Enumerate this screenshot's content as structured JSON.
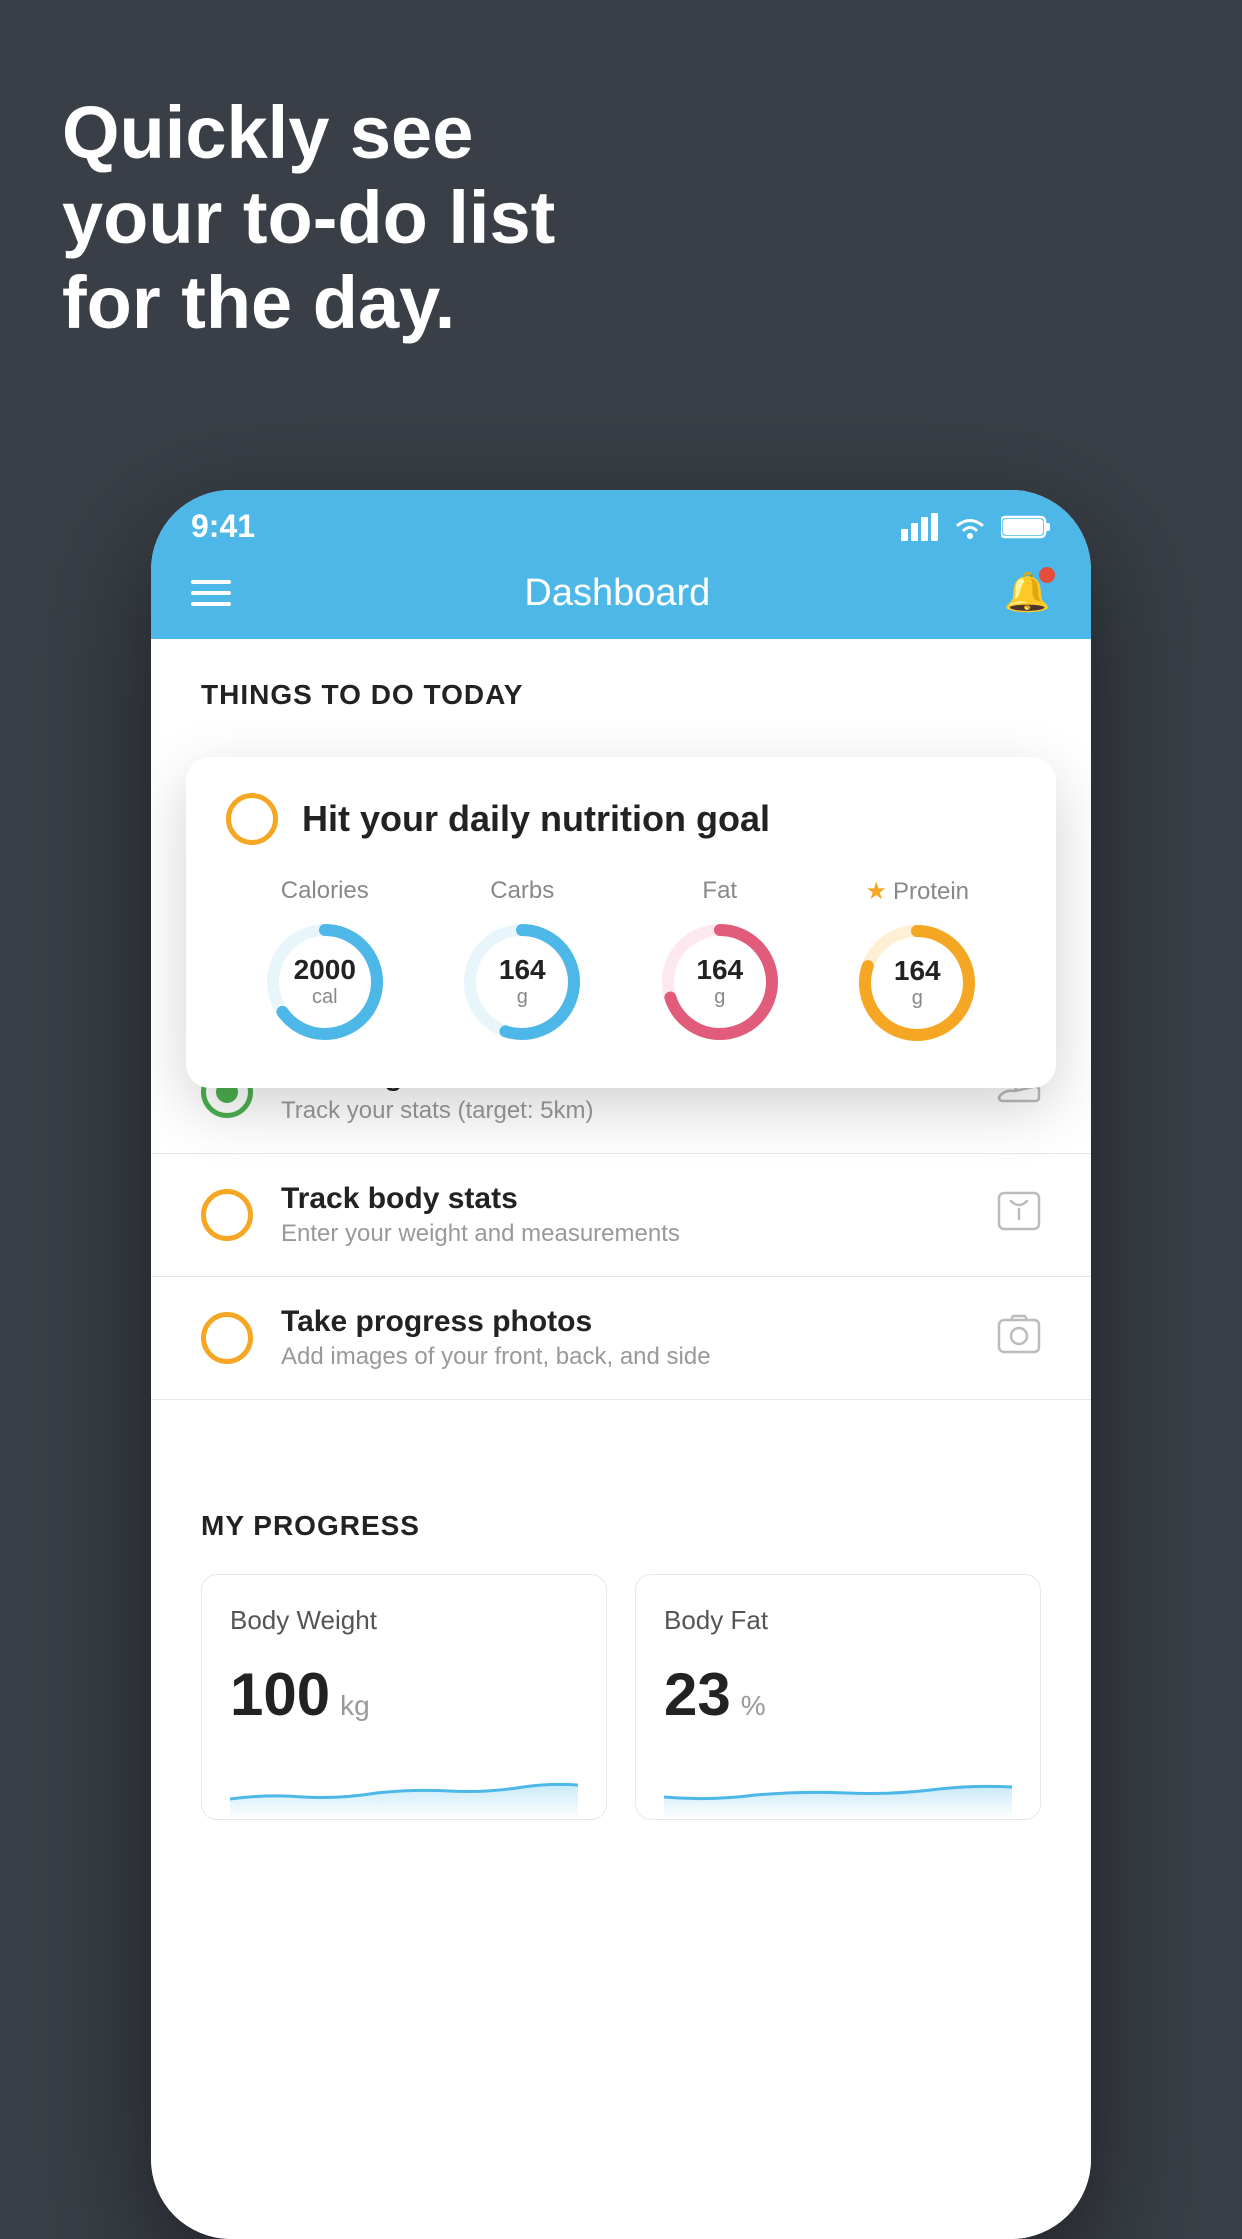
{
  "hero": {
    "text_line1": "Quickly see",
    "text_line2": "your to-do list",
    "text_line3": "for the day."
  },
  "status_bar": {
    "time": "9:41",
    "signal_icon": "signal",
    "wifi_icon": "wifi",
    "battery_icon": "battery"
  },
  "nav": {
    "title": "Dashboard",
    "menu_icon": "hamburger",
    "bell_icon": "bell"
  },
  "things_today": {
    "section_label": "THINGS TO DO TODAY",
    "floating_card": {
      "circle_icon": "circle-check",
      "title": "Hit your daily nutrition goal",
      "items": [
        {
          "label": "Calories",
          "value": "2000",
          "unit": "cal",
          "color": "#4db8e8",
          "star": false,
          "percent": 65
        },
        {
          "label": "Carbs",
          "value": "164",
          "unit": "g",
          "color": "#4db8e8",
          "star": false,
          "percent": 55
        },
        {
          "label": "Fat",
          "value": "164",
          "unit": "g",
          "color": "#e05c7a",
          "star": false,
          "percent": 70
        },
        {
          "label": "Protein",
          "value": "164",
          "unit": "g",
          "color": "#f5a623",
          "star": true,
          "percent": 80
        }
      ]
    },
    "todo_items": [
      {
        "name": "Running",
        "sub": "Track your stats (target: 5km)",
        "circle": "green",
        "icon": "shoe-icon"
      },
      {
        "name": "Track body stats",
        "sub": "Enter your weight and measurements",
        "circle": "yellow",
        "icon": "scale-icon"
      },
      {
        "name": "Take progress photos",
        "sub": "Add images of your front, back, and side",
        "circle": "yellow",
        "icon": "photo-icon"
      }
    ]
  },
  "progress": {
    "section_label": "MY PROGRESS",
    "cards": [
      {
        "title": "Body Weight",
        "value": "100",
        "unit": "kg"
      },
      {
        "title": "Body Fat",
        "value": "23",
        "unit": "%"
      }
    ]
  }
}
